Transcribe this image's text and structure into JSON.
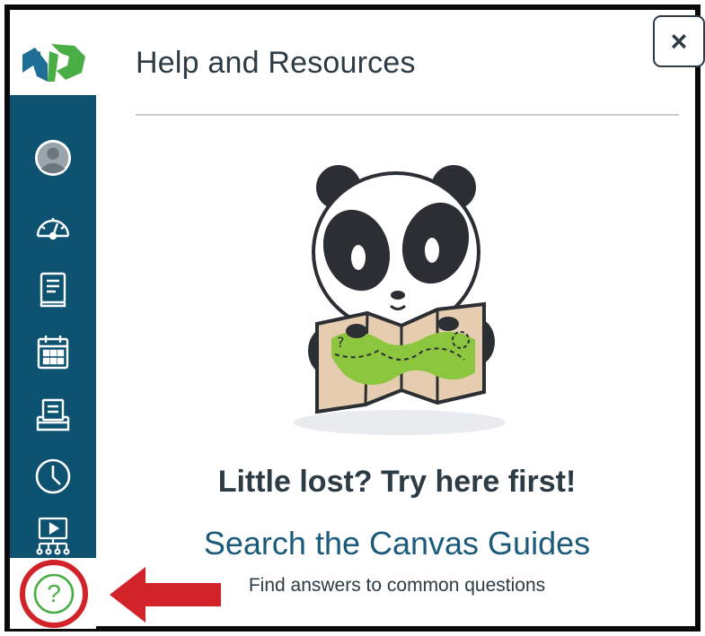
{
  "panel": {
    "title": "Help and Resources",
    "close_label": "×",
    "headline": "Little lost? Try here first!",
    "guides_link": "Search the Canvas Guides",
    "guides_subtext": "Find answers to common questions"
  },
  "sidebar": {
    "items": [
      {
        "icon": "account-icon"
      },
      {
        "icon": "dashboard-icon"
      },
      {
        "icon": "courses-icon"
      },
      {
        "icon": "calendar-icon"
      },
      {
        "icon": "inbox-icon"
      },
      {
        "icon": "history-icon"
      },
      {
        "icon": "studio-icon"
      },
      {
        "icon": "help-icon",
        "help_glyph": "?"
      }
    ]
  },
  "colors": {
    "sidebar": "#0e5272",
    "help_highlight": "#d2232a",
    "arrow": "#d2232a",
    "logo_blue": "#1f6e96",
    "logo_green": "#4aae46",
    "text": "#2d3b45",
    "link": "#1a5a7a"
  }
}
